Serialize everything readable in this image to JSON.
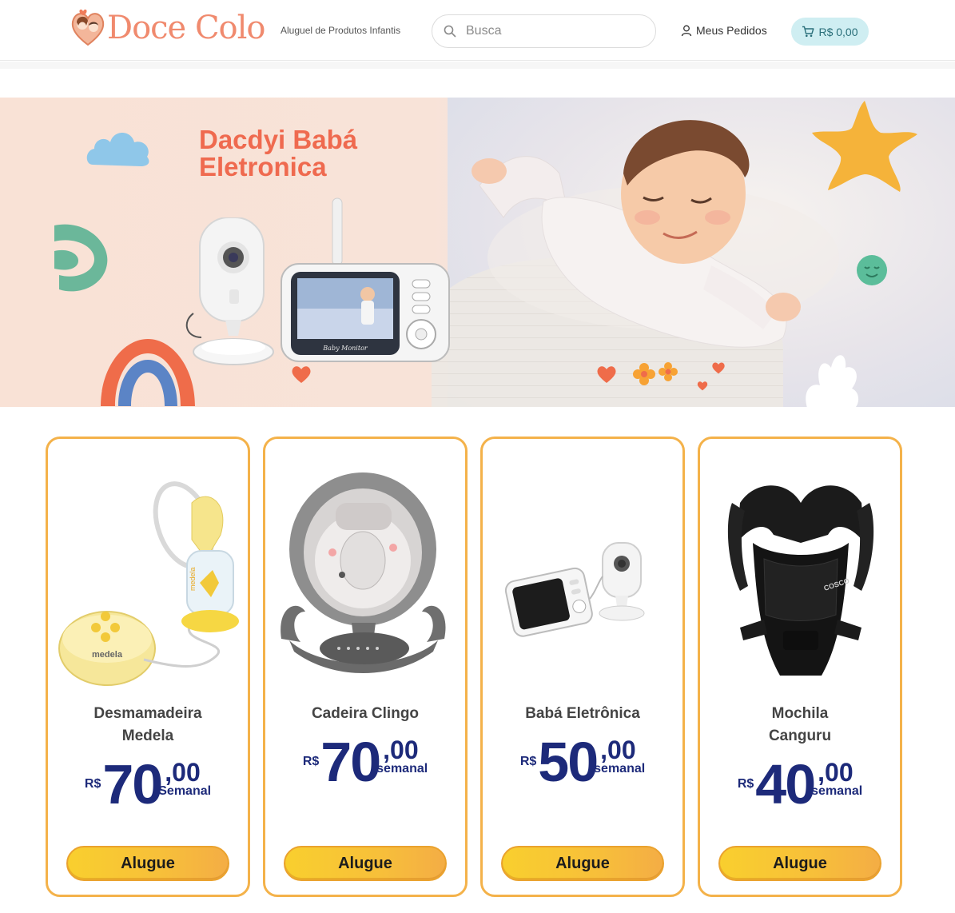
{
  "header": {
    "logo_text": "Doce Colo",
    "tagline": "Aluguel de Produtos Infantis",
    "search_placeholder": "Busca",
    "orders_label": "Meus Pedidos",
    "cart_total": "R$ 0,00"
  },
  "banner": {
    "title_line1": "Dacdyi Babá",
    "title_line2": "Eletronica",
    "monitor_label": "Baby Monitor"
  },
  "products": [
    {
      "name_line1": "Desmamadeira",
      "name_line2": "Medela",
      "currency": "R$",
      "price_int": "70",
      "price_cents": ",00",
      "period": "Semanal",
      "button": "Alugue",
      "brand_text": "medela"
    },
    {
      "name_line1": "Cadeira Clingo",
      "name_line2": "",
      "currency": "R$",
      "price_int": "70",
      "price_cents": ",00",
      "period": "semanal",
      "button": "Alugue"
    },
    {
      "name_line1": "Babá Eletrônica",
      "name_line2": "",
      "currency": "R$",
      "price_int": "50",
      "price_cents": ",00",
      "period": "semanal",
      "button": "Alugue"
    },
    {
      "name_line1": "Mochila",
      "name_line2": "Canguru",
      "currency": "R$",
      "price_int": "40",
      "price_cents": ",00",
      "period": "semanal",
      "button": "Alugue",
      "brand_text": "COSCO"
    }
  ],
  "colors": {
    "accent_orange": "#f08a6e",
    "card_border": "#f4b24a",
    "price_blue": "#1d2a7a",
    "cart_bg": "#cfeef2"
  }
}
